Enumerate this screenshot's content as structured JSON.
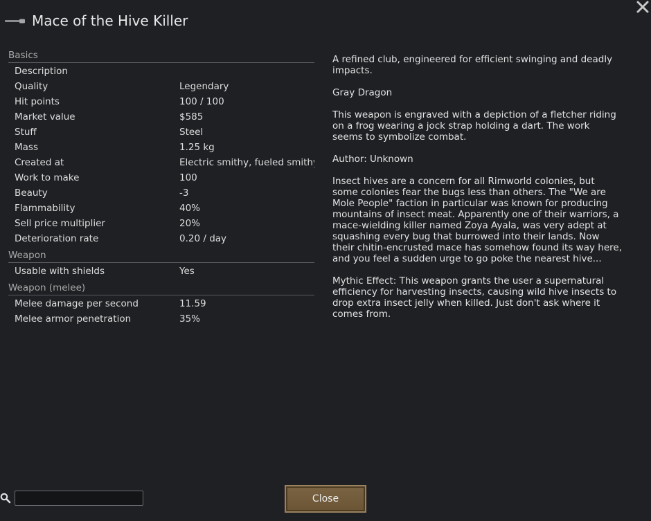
{
  "window": {
    "title": "Mace of the Hive Killer",
    "title_icon": "mace-icon",
    "close_icon": "close-icon"
  },
  "stats": {
    "sections": [
      {
        "header": "Basics",
        "rows": [
          {
            "label": "Description",
            "value": ""
          },
          {
            "label": "Quality",
            "value": "Legendary"
          },
          {
            "label": "Hit points",
            "value": "100 / 100"
          },
          {
            "label": "Market value",
            "value": "$585"
          },
          {
            "label": "Stuff",
            "value": "Steel"
          },
          {
            "label": "Mass",
            "value": "1.25 kg"
          },
          {
            "label": "Created at",
            "value": "Electric smithy, fueled smithy"
          },
          {
            "label": "Work to make",
            "value": "100"
          },
          {
            "label": "Beauty",
            "value": "-3"
          },
          {
            "label": "Flammability",
            "value": "40%"
          },
          {
            "label": "Sell price multiplier",
            "value": "20%"
          },
          {
            "label": "Deterioration rate",
            "value": "0.20 / day"
          }
        ]
      },
      {
        "header": "Weapon",
        "rows": [
          {
            "label": "Usable with shields",
            "value": "Yes"
          }
        ]
      },
      {
        "header": "Weapon (melee)",
        "rows": [
          {
            "label": "Melee damage per second",
            "value": "11.59"
          },
          {
            "label": "Melee armor penetration",
            "value": "35%"
          }
        ]
      }
    ]
  },
  "description": {
    "paragraphs": [
      "A refined club, engineered for efficient swinging and deadly impacts.",
      "Gray Dragon",
      "This weapon is engraved with a depiction of a fletcher riding on a frog wearing a jock strap holding a dart. The work seems to symbolize combat.",
      "Author: Unknown",
      "Insect hives are a concern for all Rimworld colonies, but some colonies fear the bugs less than others. The \"We are Mole People\" faction in particular was known for producing mountains of insect meat. Apparently one of their warriors, a mace-wielding killer named Zoya Ayala, was very adept at squashing every bug that burrowed into their lands. Now their chitin-encrusted mace has somehow found its way here, and you feel a sudden urge to go poke the nearest hive...",
      "Mythic Effect: This weapon grants the user a supernatural efficiency for harvesting insects, causing wild hive insects to drop extra insect jelly when killed. Just don't ask where it comes from."
    ]
  },
  "footer": {
    "search_icon": "search-icon",
    "search_value": "",
    "close_label": "Close"
  },
  "colors": {
    "background": "#1e2023",
    "button_fill": "#6f5a3a",
    "section_header_text": "#a9a9a9"
  }
}
